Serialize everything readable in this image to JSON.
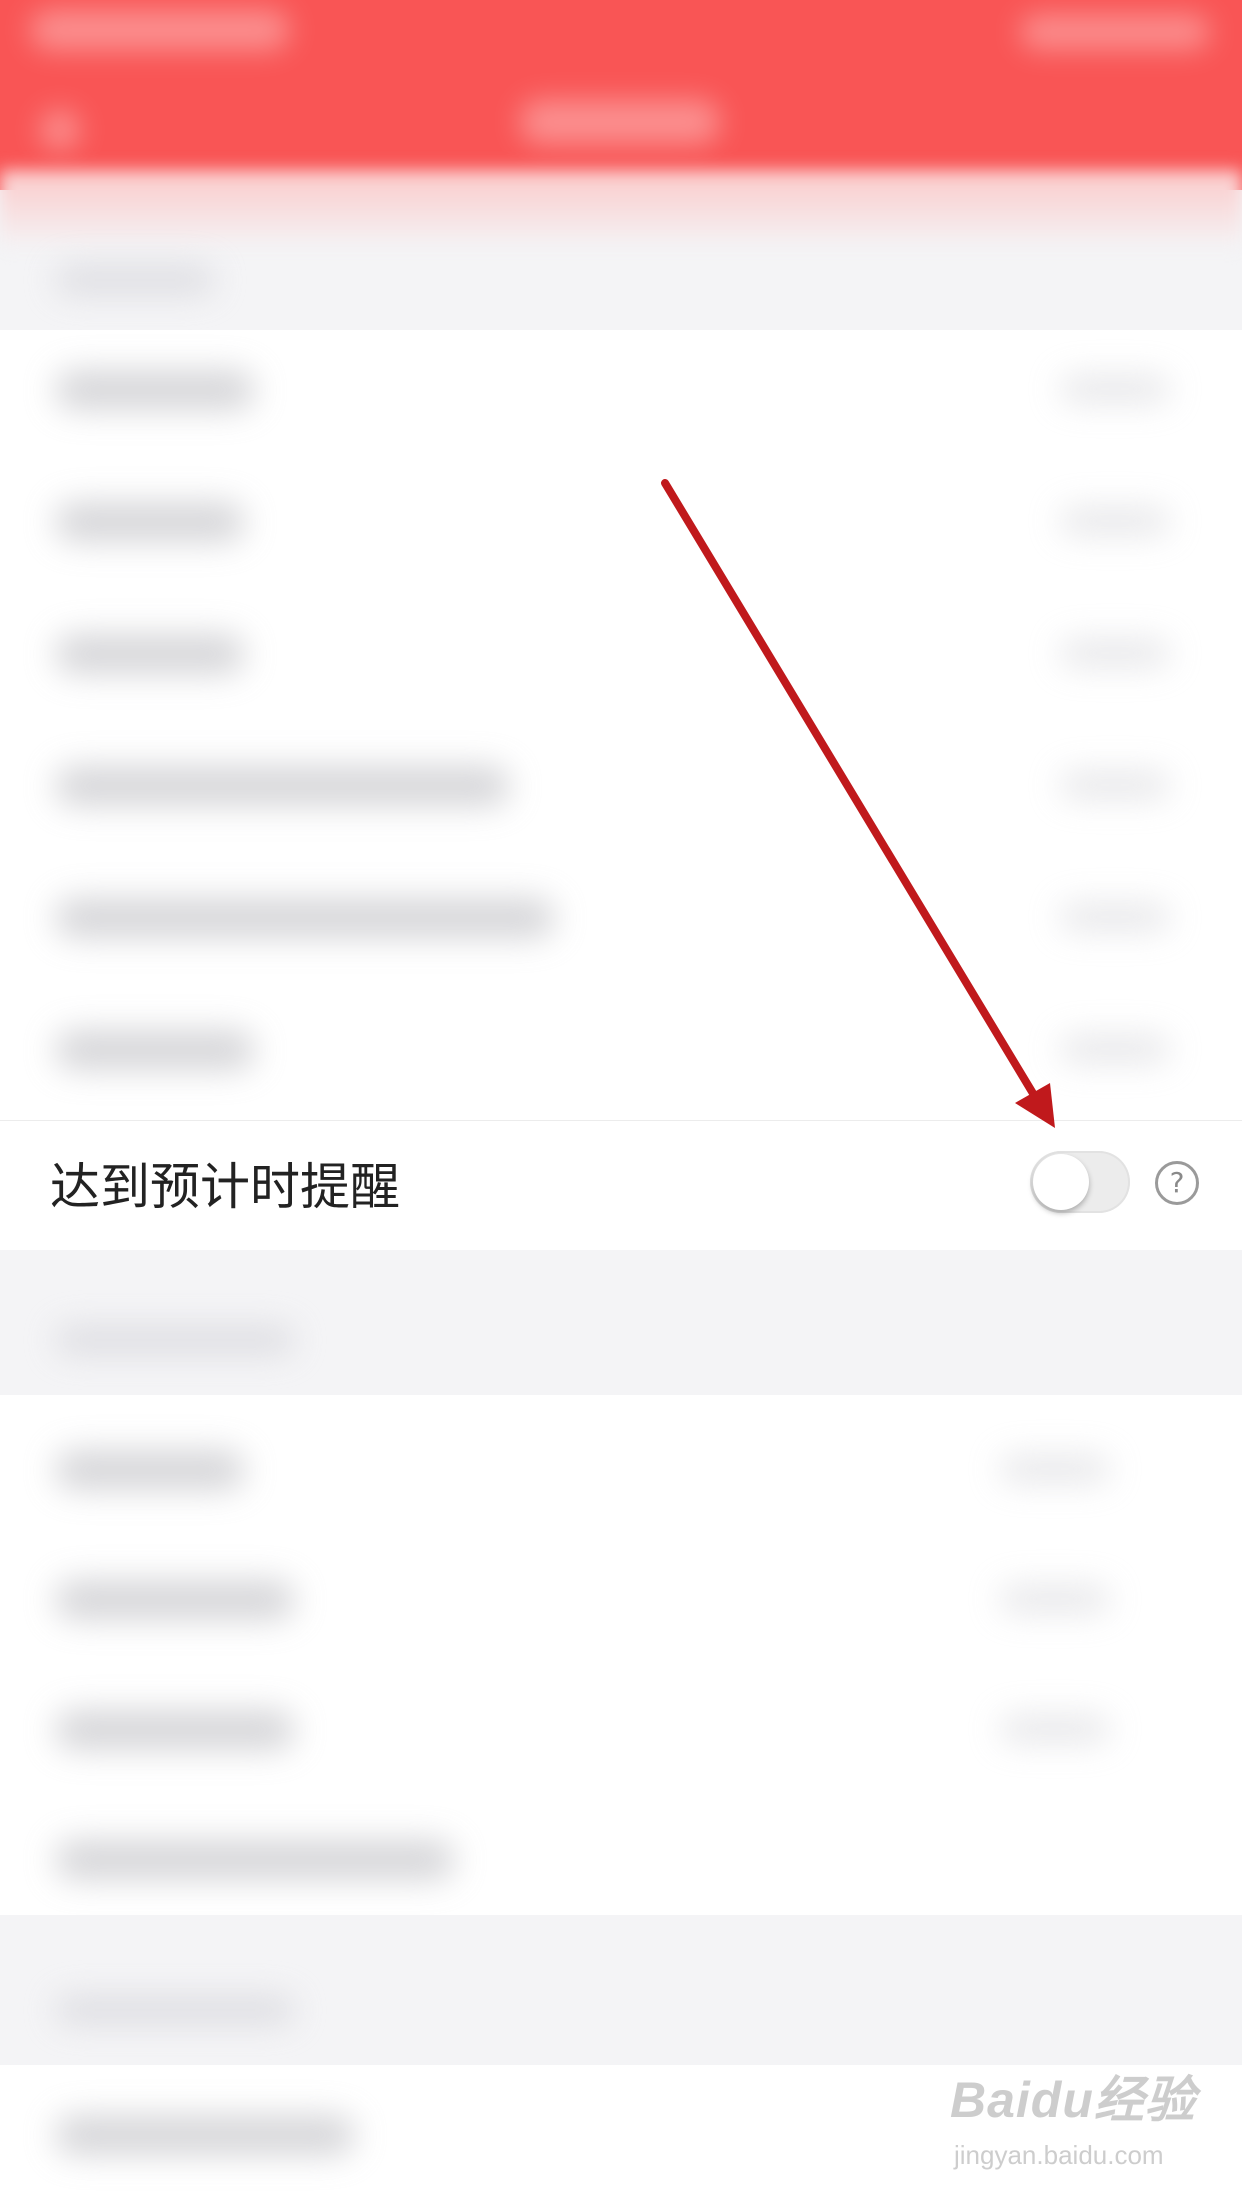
{
  "remind_row": {
    "label": "达到预计时提醒",
    "toggle_on": false,
    "help_glyph": "?"
  },
  "watermark": {
    "logo_text": "Baidu经验",
    "url_text": "jingyan.baidu.com"
  },
  "colors": {
    "header": "#f95555",
    "arrow": "#c0191c",
    "toggle_off": "#ececec"
  }
}
